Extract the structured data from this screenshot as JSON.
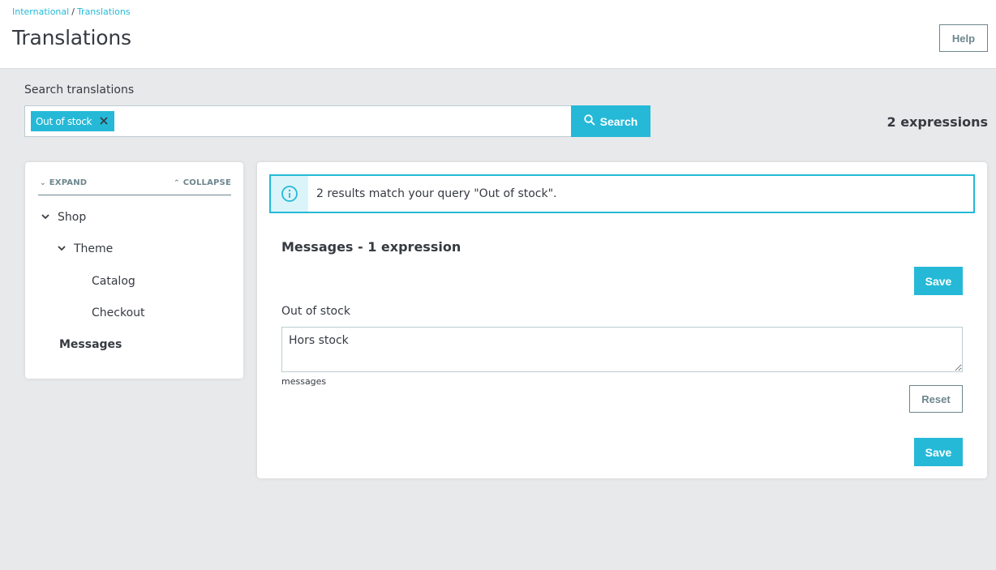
{
  "header": {
    "breadcrumb": [
      {
        "label": "International"
      },
      {
        "label": "Translations"
      }
    ],
    "breadcrumb_separator": "/",
    "title": "Translations",
    "help_label": "Help"
  },
  "search": {
    "label": "Search translations",
    "tags": [
      {
        "label": "Out of stock",
        "remove_icon": "close-icon"
      }
    ],
    "button_label": "Search",
    "button_icon": "search-icon",
    "expressions_count": "2 expressions"
  },
  "tree": {
    "expand_label": "EXPAND",
    "collapse_label": "COLLAPSE",
    "items": [
      {
        "label": "Shop",
        "level": 0,
        "expanded": true
      },
      {
        "label": "Theme",
        "level": 1,
        "expanded": true
      },
      {
        "label": "Catalog",
        "level": 2
      },
      {
        "label": "Checkout",
        "level": 2
      },
      {
        "label": "Messages",
        "level": 0,
        "selected": true
      }
    ]
  },
  "main": {
    "alert": {
      "icon": "info-icon",
      "message": "2 results match your query \"Out of stock\"."
    },
    "section_title": "Messages - 1 expression",
    "save_label": "Save",
    "expression": {
      "label": "Out of stock",
      "value": "Hors stock",
      "domain": "messages",
      "reset_label": "Reset"
    }
  },
  "colors": {
    "accent": "#25b9d7",
    "text": "#363a41",
    "secondary": "#6c868e",
    "background": "#e8e9eb"
  }
}
